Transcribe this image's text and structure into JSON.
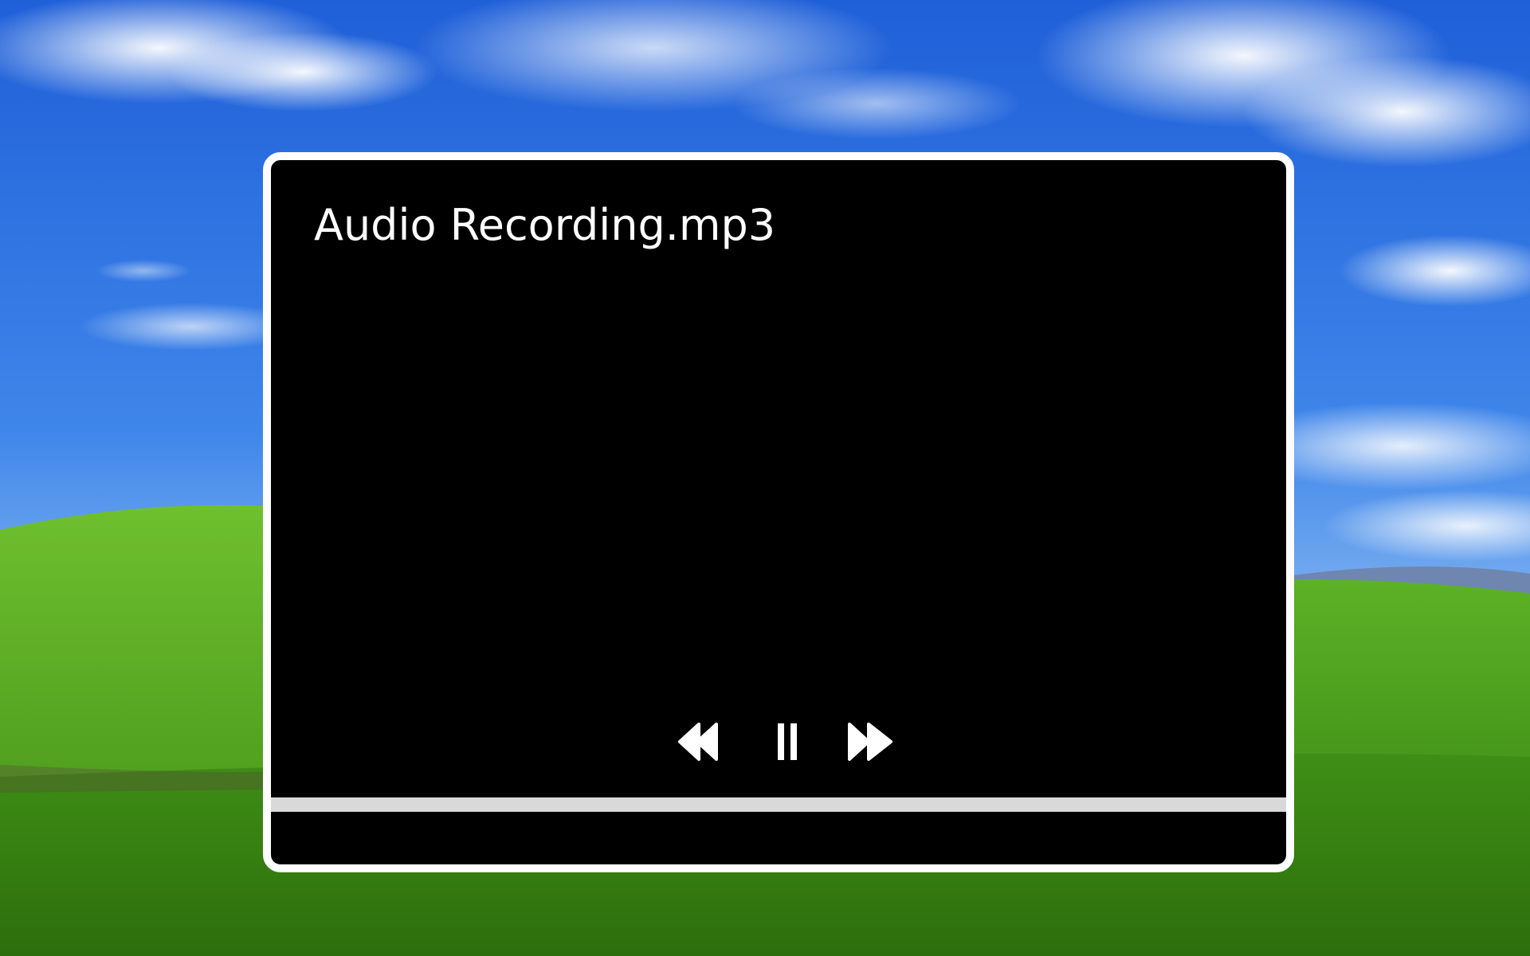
{
  "wallpaper": {
    "name": "bliss-wallpaper",
    "sky_color": "#2f6fe0",
    "hill_color": "#4f9e1f"
  },
  "player": {
    "title": "Audio Recording.mp3",
    "controls": {
      "rewind_icon": "rewind-icon",
      "pause_icon": "pause-icon",
      "forward_icon": "fast-forward-icon"
    },
    "progress_fraction": 0,
    "colors": {
      "background": "#000000",
      "frame": "#ffffff",
      "progress_track": "#d9d9d9",
      "icon": "#ffffff"
    }
  }
}
